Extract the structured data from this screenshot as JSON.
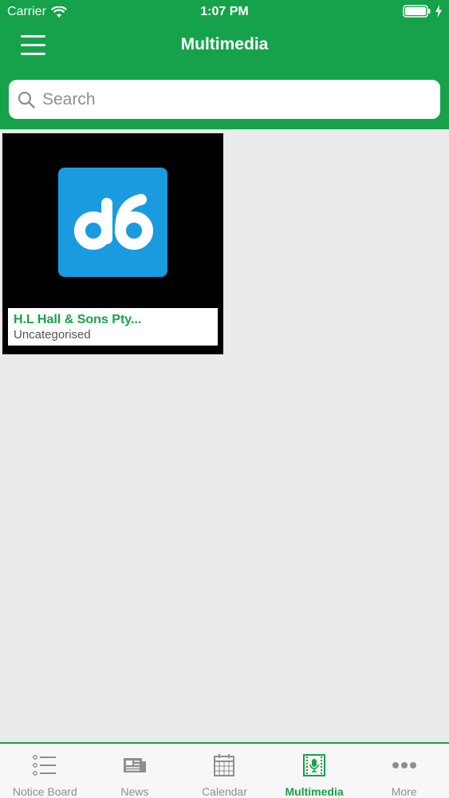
{
  "status_bar": {
    "carrier": "Carrier",
    "time": "1:07 PM"
  },
  "header": {
    "title": "Multimedia"
  },
  "search": {
    "placeholder": "Search"
  },
  "media": [
    {
      "title": "H.L Hall & Sons Pty...",
      "category": "Uncategorised",
      "thumb_color": "#1a9be0"
    }
  ],
  "tabs": [
    {
      "label": "Notice Board",
      "icon": "list-icon"
    },
    {
      "label": "News",
      "icon": "newspaper-icon"
    },
    {
      "label": "Calendar",
      "icon": "calendar-icon"
    },
    {
      "label": "Multimedia",
      "icon": "microphone-icon",
      "active": true
    },
    {
      "label": "More",
      "icon": "more-icon"
    }
  ],
  "colors": {
    "accent": "#16a24a",
    "background": "#ebebeb",
    "inactive": "#8e8e8e"
  }
}
